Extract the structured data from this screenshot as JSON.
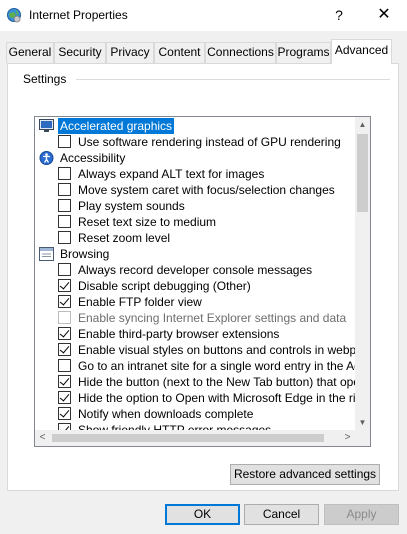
{
  "window": {
    "title": "Internet Properties",
    "help_glyph": "?",
    "close_glyph": "✕"
  },
  "tabs": [
    {
      "label": "General",
      "active": false
    },
    {
      "label": "Security",
      "active": false
    },
    {
      "label": "Privacy",
      "active": false
    },
    {
      "label": "Content",
      "active": false
    },
    {
      "label": "Connections",
      "active": false
    },
    {
      "label": "Programs",
      "active": false
    },
    {
      "label": "Advanced",
      "active": true
    }
  ],
  "settings": {
    "group_label": "Settings",
    "items": [
      {
        "type": "category",
        "icon": "monitor-icon",
        "label": "Accelerated graphics",
        "selected": true
      },
      {
        "type": "option",
        "checked": false,
        "label": "Use software rendering instead of GPU rendering"
      },
      {
        "type": "category",
        "icon": "accessibility-icon",
        "label": "Accessibility"
      },
      {
        "type": "option",
        "checked": false,
        "label": "Always expand ALT text for images"
      },
      {
        "type": "option",
        "checked": false,
        "label": "Move system caret with focus/selection changes"
      },
      {
        "type": "option",
        "checked": false,
        "label": "Play system sounds"
      },
      {
        "type": "option",
        "checked": false,
        "label": "Reset text size to medium"
      },
      {
        "type": "option",
        "checked": false,
        "label": "Reset zoom level"
      },
      {
        "type": "category",
        "icon": "browsing-icon",
        "label": "Browsing"
      },
      {
        "type": "option",
        "checked": false,
        "label": "Always record developer console messages"
      },
      {
        "type": "option",
        "checked": true,
        "label": "Disable script debugging (Other)"
      },
      {
        "type": "option",
        "checked": true,
        "label": "Enable FTP folder view"
      },
      {
        "type": "option",
        "checked": false,
        "disabled": true,
        "label": "Enable syncing Internet Explorer settings and data"
      },
      {
        "type": "option",
        "checked": true,
        "label": "Enable third-party browser extensions"
      },
      {
        "type": "option",
        "checked": true,
        "label": "Enable visual styles on buttons and controls in webpages"
      },
      {
        "type": "option",
        "checked": false,
        "label": "Go to an intranet site for a single word entry in the Addres"
      },
      {
        "type": "option",
        "checked": true,
        "label": "Hide the button (next to the New Tab button) that opens"
      },
      {
        "type": "option",
        "checked": true,
        "label": "Hide the option to Open with Microsoft Edge in the right-cl"
      },
      {
        "type": "option",
        "checked": true,
        "label": "Notify when downloads complete"
      },
      {
        "type": "option",
        "checked": true,
        "label": "Show friendly HTTP error messages"
      }
    ]
  },
  "scrollbar": {
    "up": "▲",
    "down": "▼",
    "left": "<",
    "right": ">"
  },
  "buttons": {
    "restore": "Restore advanced settings",
    "ok": "OK",
    "cancel": "Cancel",
    "apply": "Apply"
  }
}
